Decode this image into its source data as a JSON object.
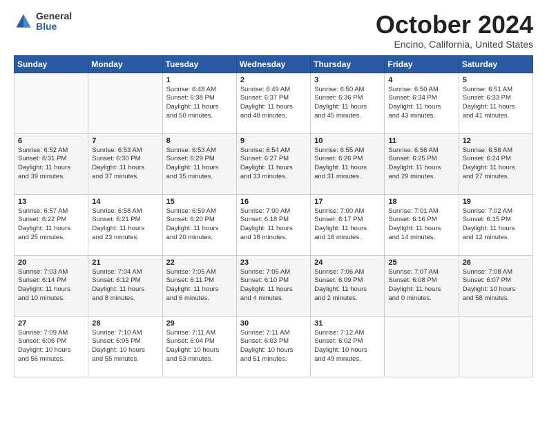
{
  "header": {
    "logo_general": "General",
    "logo_blue": "Blue",
    "title": "October 2024",
    "location": "Encino, California, United States"
  },
  "days_of_week": [
    "Sunday",
    "Monday",
    "Tuesday",
    "Wednesday",
    "Thursday",
    "Friday",
    "Saturday"
  ],
  "weeks": [
    [
      {
        "day": "",
        "content": ""
      },
      {
        "day": "",
        "content": ""
      },
      {
        "day": "1",
        "content": "Sunrise: 6:48 AM\nSunset: 6:38 PM\nDaylight: 11 hours\nand 50 minutes."
      },
      {
        "day": "2",
        "content": "Sunrise: 6:49 AM\nSunset: 6:37 PM\nDaylight: 11 hours\nand 48 minutes."
      },
      {
        "day": "3",
        "content": "Sunrise: 6:50 AM\nSunset: 6:36 PM\nDaylight: 11 hours\nand 45 minutes."
      },
      {
        "day": "4",
        "content": "Sunrise: 6:50 AM\nSunset: 6:34 PM\nDaylight: 11 hours\nand 43 minutes."
      },
      {
        "day": "5",
        "content": "Sunrise: 6:51 AM\nSunset: 6:33 PM\nDaylight: 11 hours\nand 41 minutes."
      }
    ],
    [
      {
        "day": "6",
        "content": "Sunrise: 6:52 AM\nSunset: 6:31 PM\nDaylight: 11 hours\nand 39 minutes."
      },
      {
        "day": "7",
        "content": "Sunrise: 6:53 AM\nSunset: 6:30 PM\nDaylight: 11 hours\nand 37 minutes."
      },
      {
        "day": "8",
        "content": "Sunrise: 6:53 AM\nSunset: 6:29 PM\nDaylight: 11 hours\nand 35 minutes."
      },
      {
        "day": "9",
        "content": "Sunrise: 6:54 AM\nSunset: 6:27 PM\nDaylight: 11 hours\nand 33 minutes."
      },
      {
        "day": "10",
        "content": "Sunrise: 6:55 AM\nSunset: 6:26 PM\nDaylight: 11 hours\nand 31 minutes."
      },
      {
        "day": "11",
        "content": "Sunrise: 6:56 AM\nSunset: 6:25 PM\nDaylight: 11 hours\nand 29 minutes."
      },
      {
        "day": "12",
        "content": "Sunrise: 6:56 AM\nSunset: 6:24 PM\nDaylight: 11 hours\nand 27 minutes."
      }
    ],
    [
      {
        "day": "13",
        "content": "Sunrise: 6:57 AM\nSunset: 6:22 PM\nDaylight: 11 hours\nand 25 minutes."
      },
      {
        "day": "14",
        "content": "Sunrise: 6:58 AM\nSunset: 6:21 PM\nDaylight: 11 hours\nand 23 minutes."
      },
      {
        "day": "15",
        "content": "Sunrise: 6:59 AM\nSunset: 6:20 PM\nDaylight: 11 hours\nand 20 minutes."
      },
      {
        "day": "16",
        "content": "Sunrise: 7:00 AM\nSunset: 6:18 PM\nDaylight: 11 hours\nand 18 minutes."
      },
      {
        "day": "17",
        "content": "Sunrise: 7:00 AM\nSunset: 6:17 PM\nDaylight: 11 hours\nand 16 minutes."
      },
      {
        "day": "18",
        "content": "Sunrise: 7:01 AM\nSunset: 6:16 PM\nDaylight: 11 hours\nand 14 minutes."
      },
      {
        "day": "19",
        "content": "Sunrise: 7:02 AM\nSunset: 6:15 PM\nDaylight: 11 hours\nand 12 minutes."
      }
    ],
    [
      {
        "day": "20",
        "content": "Sunrise: 7:03 AM\nSunset: 6:14 PM\nDaylight: 11 hours\nand 10 minutes."
      },
      {
        "day": "21",
        "content": "Sunrise: 7:04 AM\nSunset: 6:12 PM\nDaylight: 11 hours\nand 8 minutes."
      },
      {
        "day": "22",
        "content": "Sunrise: 7:05 AM\nSunset: 6:11 PM\nDaylight: 11 hours\nand 6 minutes."
      },
      {
        "day": "23",
        "content": "Sunrise: 7:05 AM\nSunset: 6:10 PM\nDaylight: 11 hours\nand 4 minutes."
      },
      {
        "day": "24",
        "content": "Sunrise: 7:06 AM\nSunset: 6:09 PM\nDaylight: 11 hours\nand 2 minutes."
      },
      {
        "day": "25",
        "content": "Sunrise: 7:07 AM\nSunset: 6:08 PM\nDaylight: 11 hours\nand 0 minutes."
      },
      {
        "day": "26",
        "content": "Sunrise: 7:08 AM\nSunset: 6:07 PM\nDaylight: 10 hours\nand 58 minutes."
      }
    ],
    [
      {
        "day": "27",
        "content": "Sunrise: 7:09 AM\nSunset: 6:06 PM\nDaylight: 10 hours\nand 56 minutes."
      },
      {
        "day": "28",
        "content": "Sunrise: 7:10 AM\nSunset: 6:05 PM\nDaylight: 10 hours\nand 55 minutes."
      },
      {
        "day": "29",
        "content": "Sunrise: 7:11 AM\nSunset: 6:04 PM\nDaylight: 10 hours\nand 53 minutes."
      },
      {
        "day": "30",
        "content": "Sunrise: 7:11 AM\nSunset: 6:03 PM\nDaylight: 10 hours\nand 51 minutes."
      },
      {
        "day": "31",
        "content": "Sunrise: 7:12 AM\nSunset: 6:02 PM\nDaylight: 10 hours\nand 49 minutes."
      },
      {
        "day": "",
        "content": ""
      },
      {
        "day": "",
        "content": ""
      }
    ]
  ]
}
